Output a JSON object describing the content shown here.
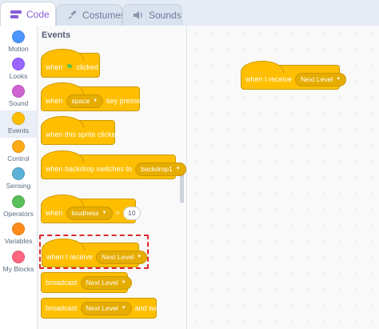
{
  "tabs": [
    {
      "label": "Code",
      "icon": "code-icon",
      "active": true
    },
    {
      "label": "Costumes",
      "icon": "paintbrush-icon",
      "active": false
    },
    {
      "label": "Sounds",
      "icon": "speaker-icon",
      "active": false
    }
  ],
  "categories": [
    {
      "label": "Motion",
      "color": "#4c97ff"
    },
    {
      "label": "Looks",
      "color": "#9966ff"
    },
    {
      "label": "Sound",
      "color": "#cf63cf"
    },
    {
      "label": "Events",
      "color": "#ffbf00",
      "selected": true
    },
    {
      "label": "Control",
      "color": "#ffab19"
    },
    {
      "label": "Sensing",
      "color": "#5cb1d6"
    },
    {
      "label": "Operators",
      "color": "#59c059"
    },
    {
      "label": "Variables",
      "color": "#ff8c1a"
    },
    {
      "label": "My Blocks",
      "color": "#ff6680"
    }
  ],
  "palette": {
    "title": "Events",
    "blocks": {
      "flag_clicked": {
        "pre": "when",
        "post": "clicked"
      },
      "key_pressed": {
        "pre": "when",
        "dropdown": "space",
        "post": "key pressed"
      },
      "sprite_clicked": {
        "text": "when this sprite clicked"
      },
      "backdrop_switches": {
        "pre": "when backdrop switches to",
        "dropdown": "backdrop1"
      },
      "loudness": {
        "pre": "when",
        "dropdown": "loudness",
        "op": ">",
        "value": "10"
      },
      "receive": {
        "pre": "when I receive",
        "dropdown": "Next Level"
      },
      "broadcast": {
        "pre": "broadcast",
        "dropdown": "Next Level"
      },
      "broadcast_wait": {
        "pre": "broadcast",
        "dropdown": "Next Level",
        "post": "and wait"
      }
    }
  },
  "script_area": {
    "receive_block": {
      "pre": "when I receive",
      "dropdown": "Next Level"
    }
  },
  "colors": {
    "events": "#ffbf00",
    "highlight": "#e0282e",
    "accent": "#855cd6"
  }
}
